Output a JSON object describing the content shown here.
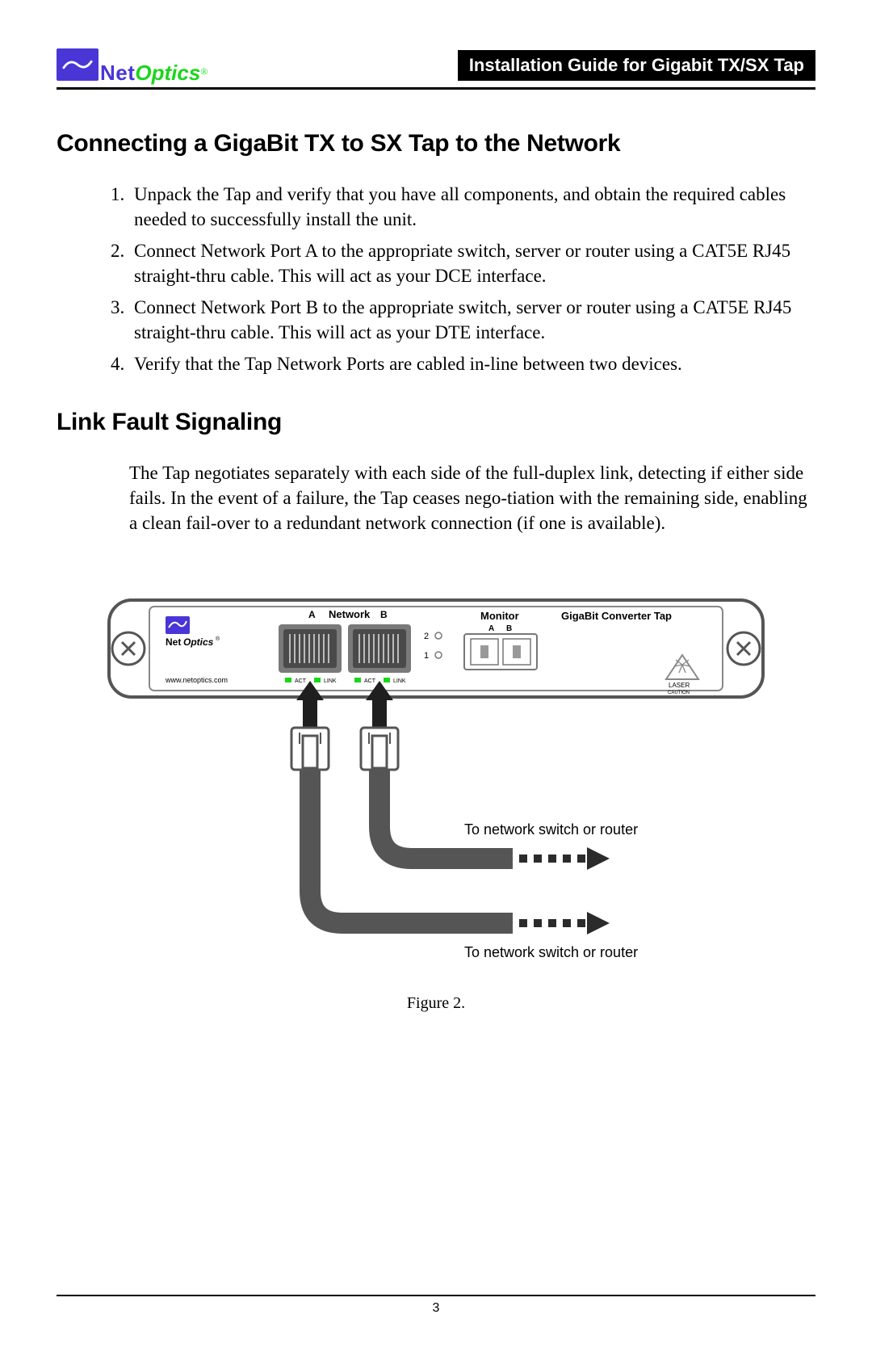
{
  "header": {
    "logo_net": "Net",
    "logo_optics": "Optics",
    "logo_reg": "®",
    "guide_title": "Installation Guide for Gigabit TX/SX Tap"
  },
  "section1": {
    "title": "Connecting a GigaBit TX to SX Tap to the Network",
    "steps": [
      "Unpack the Tap and verify that you have all components, and obtain the required cables needed to successfully install the unit.",
      "Connect Network Port A to the appropriate switch, server or router using a CAT5E RJ45 straight-thru cable. This will act as your DCE interface.",
      "Connect Network Port B to the appropriate switch, server or router using a CAT5E RJ45 straight-thru cable. This will act as your DTE interface.",
      "Verify that the Tap Network Ports are cabled in-line between two devices."
    ]
  },
  "section2": {
    "title": "Link Fault Signaling",
    "body": "The Tap negotiates separately with each side of the full-duplex link, detecting if either side fails. In the event of a failure, the Tap ceases nego-tiation with the remaining side, enabling a clean fail-over to a redundant network connection (if one is available)."
  },
  "diagram": {
    "device_label_network": "Network",
    "device_label_a": "A",
    "device_label_b": "B",
    "device_label_monitor": "Monitor",
    "device_label_monitor_a": "A",
    "device_label_monitor_b": "B",
    "device_label_product": "GigaBit Converter Tap",
    "device_url": "www.netoptics.com",
    "device_led_act": "ACT",
    "device_led_link": "LINK",
    "device_led_2": "2",
    "device_led_1": "1",
    "device_laser": "LASER",
    "device_caution": "CAUTION",
    "device_logo_net": "Net",
    "device_logo_optics": "Optics",
    "device_logo_reg": "®",
    "cable_label_1": "To network switch or router",
    "cable_label_2": "To network switch or router",
    "caption": "Figure 2."
  },
  "footer": {
    "page": "3"
  }
}
